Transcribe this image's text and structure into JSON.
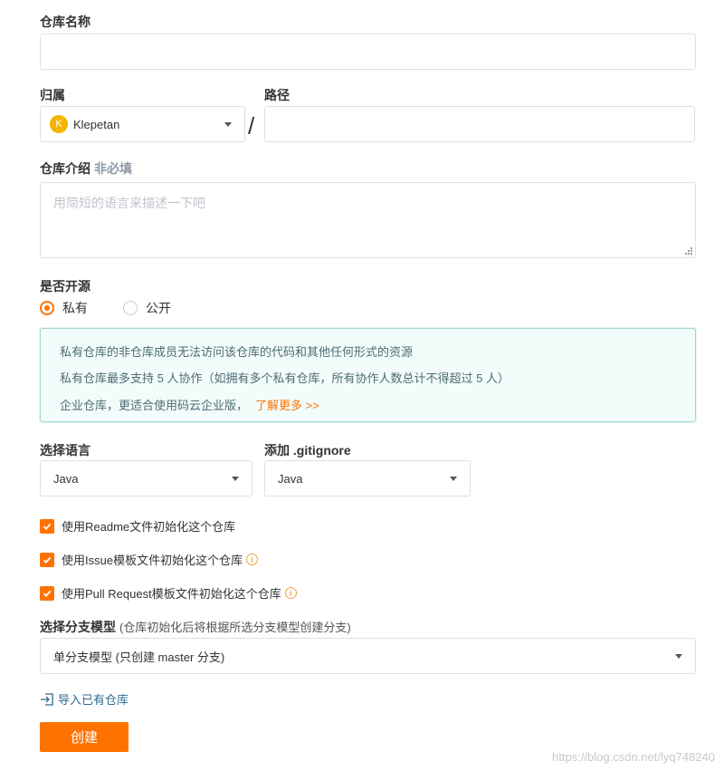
{
  "repo_name": {
    "label": "仓库名称",
    "value": ""
  },
  "owner": {
    "label": "归属",
    "avatar_letter": "K",
    "value": "Klepetan"
  },
  "separator": "/",
  "path": {
    "label": "路径",
    "value": ""
  },
  "description": {
    "label": "仓库介绍",
    "optional": "非必填",
    "placeholder": "用简短的语言来描述一下吧"
  },
  "visibility": {
    "label": "是否开源",
    "options": [
      {
        "label": "私有",
        "selected": true
      },
      {
        "label": "公开",
        "selected": false
      }
    ]
  },
  "notice": {
    "line1": "私有仓库的非仓库成员无法访问该仓库的代码和其他任何形式的资源",
    "line2": "私有仓库最多支持 5 人协作（如拥有多个私有仓库，所有协作人数总计不得超过 5 人）",
    "line3": "企业仓库，更适合使用码云企业版，",
    "link": "了解更多 >>"
  },
  "language": {
    "label": "选择语言",
    "value": "Java"
  },
  "gitignore": {
    "label": "添加 .gitignore",
    "value": "Java"
  },
  "checkboxes": [
    {
      "label": "使用Readme文件初始化这个仓库",
      "checked": true,
      "info": false
    },
    {
      "label": "使用Issue模板文件初始化这个仓库",
      "checked": true,
      "info": true
    },
    {
      "label": "使用Pull Request模板文件初始化这个仓库",
      "checked": true,
      "info": true
    }
  ],
  "branch_model": {
    "label": "选择分支模型",
    "hint": "(仓库初始化后将根据所选分支模型创建分支)",
    "value": "单分支模型 (只创建 master 分支)"
  },
  "import_link": "导入已有仓库",
  "create_button": "创建",
  "watermark": "https://blog.csdn.net/lyq748240",
  "colors": {
    "accent": "#fe7300",
    "notice_border": "#9fd6cf",
    "notice_bg": "#f2fcfb",
    "link": "#2d6a8f"
  },
  "icons": {
    "info": "info-icon",
    "import": "import-icon",
    "caret": "caret-down-icon",
    "check": "check-icon"
  }
}
